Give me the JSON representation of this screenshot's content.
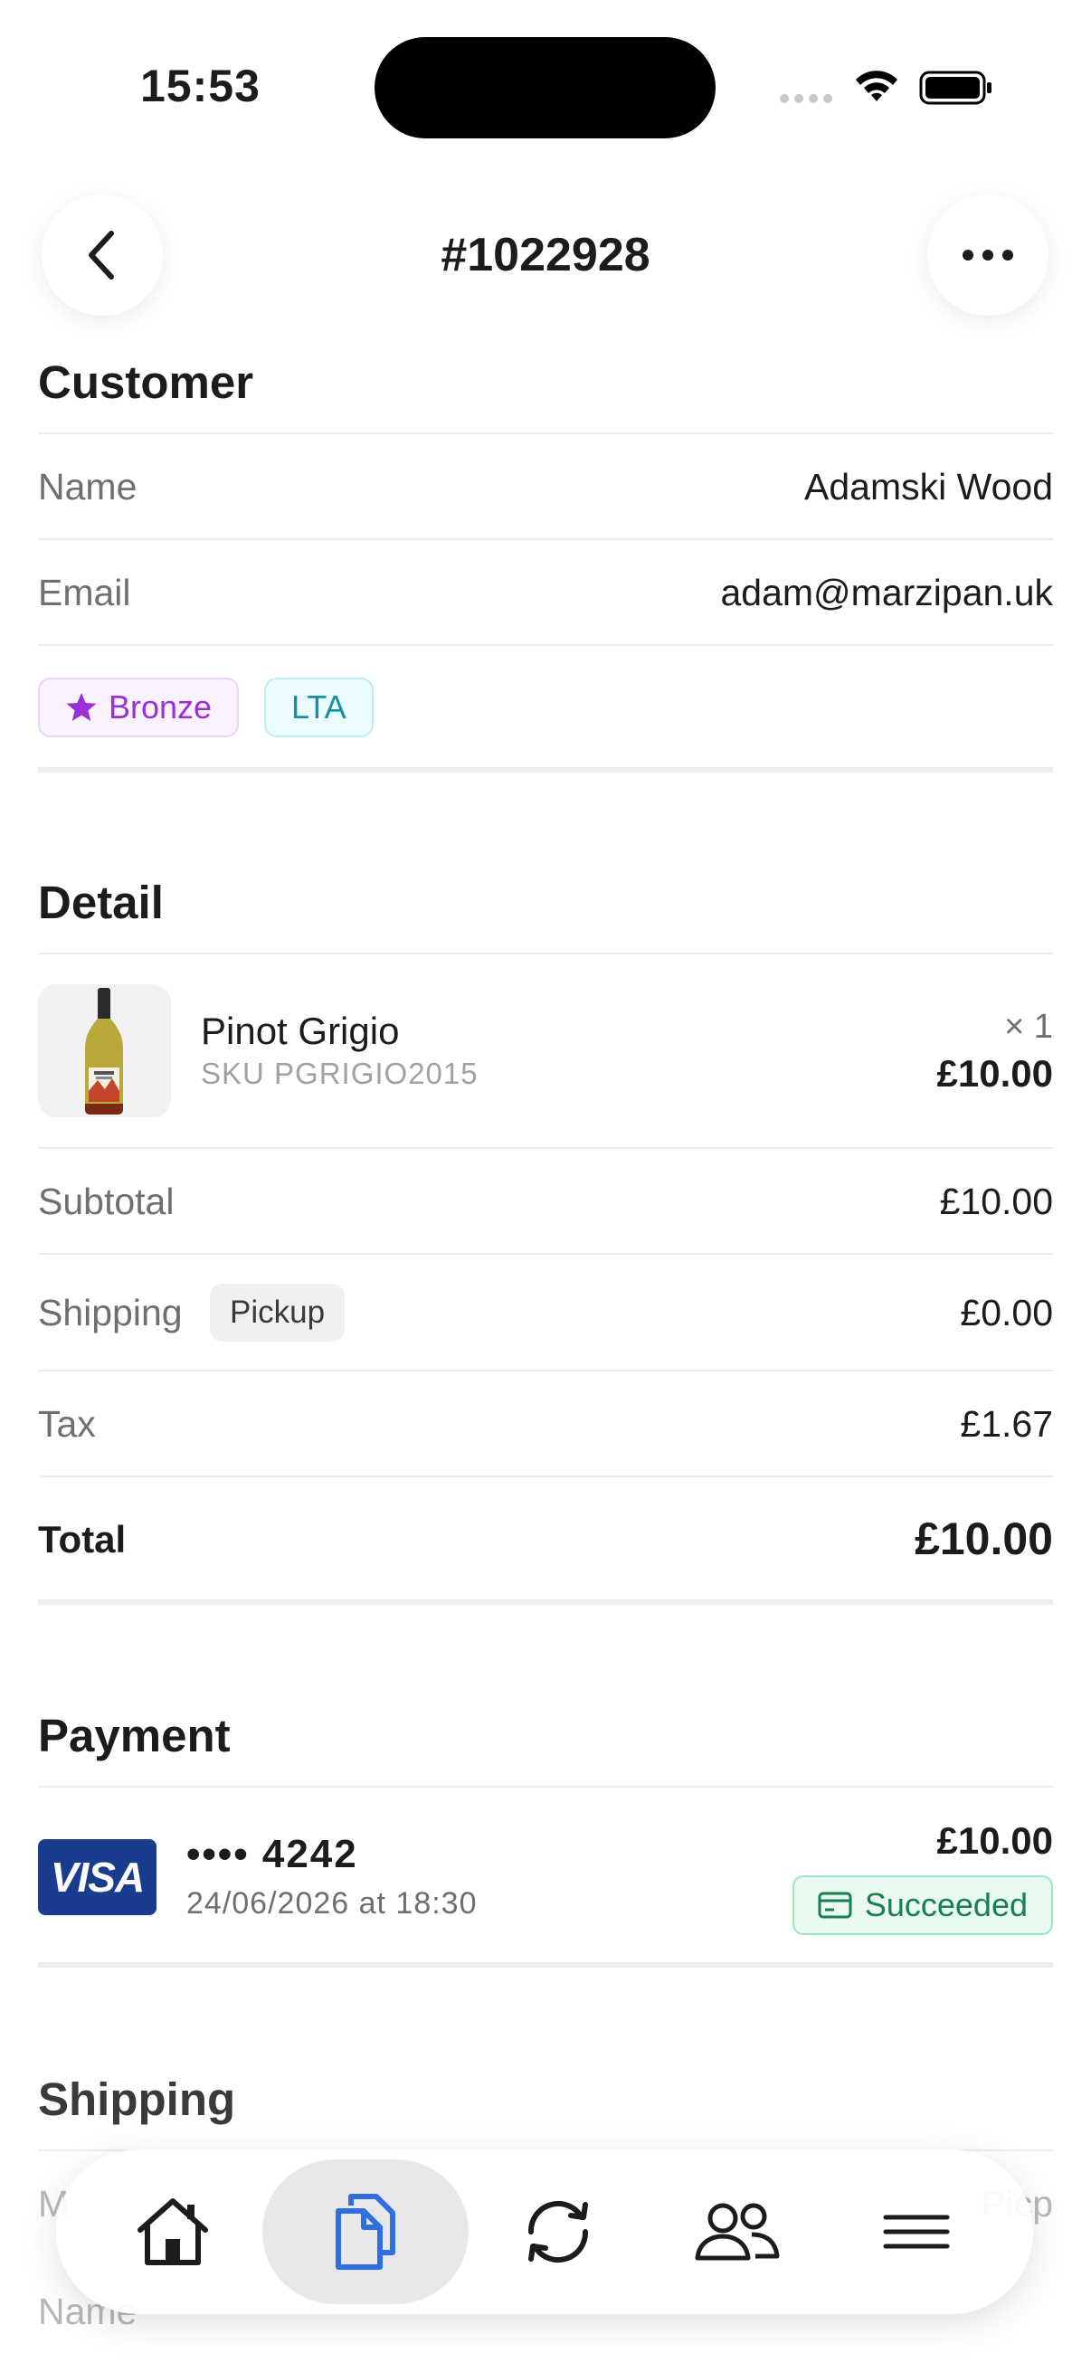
{
  "status_bar": {
    "time": "15:53"
  },
  "header": {
    "order_number": "#1022928"
  },
  "customer": {
    "title": "Customer",
    "name_label": "Name",
    "name_value": "Adamski Wood",
    "email_label": "Email",
    "email_value": "adam@marzipan.uk",
    "tags": [
      "Bronze",
      "LTA"
    ]
  },
  "detail": {
    "title": "Detail",
    "item": {
      "name": "Pinot Grigio",
      "sku": "SKU PGRIGIO2015",
      "qty": "× 1",
      "price": "£10.00"
    },
    "subtotal_label": "Subtotal",
    "subtotal_value": "£10.00",
    "shipping_label": "Shipping",
    "shipping_method": "Pickup",
    "shipping_value": "£0.00",
    "tax_label": "Tax",
    "tax_value": "£1.67",
    "total_label": "Total",
    "total_value": "£10.00"
  },
  "payment": {
    "title": "Payment",
    "card_brand": "VISA",
    "card_number": "•••• 4242",
    "date": "24/06/2026 at 18:30",
    "amount": "£10.00",
    "status": "Succeeded"
  },
  "shipping": {
    "title": "Shipping",
    "method_label_partial": "M",
    "method_value_partial": "Pic",
    "method_value_tail": "p",
    "name_label_partial": "Name"
  },
  "tab_bar": {
    "tabs": [
      "home-icon",
      "orders-icon",
      "sync-icon",
      "customers-icon",
      "menu-icon"
    ],
    "active": "orders-icon"
  },
  "colors": {
    "accent": "#2f6fe0",
    "bronze": "#9b30d9",
    "lta": "#1a8fa3",
    "success": "#1a7f4c",
    "visa": "#1a3c8f"
  }
}
